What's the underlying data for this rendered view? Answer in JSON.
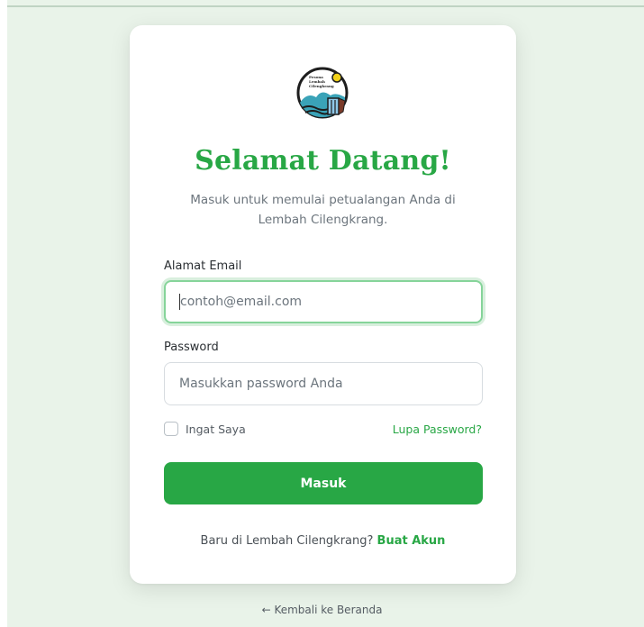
{
  "logo": {
    "line1": "Pesona",
    "line2": "Lembah",
    "line3": "Cilengkrang"
  },
  "heading": {
    "title": "Selamat Datang!",
    "subtitle": "Masuk untuk memulai petualangan Anda di Lembah Cilengkrang."
  },
  "form": {
    "email_label": "Alamat Email",
    "email_value": "",
    "email_placeholder": "contoh@email.com",
    "password_label": "Password",
    "password_value": "",
    "password_placeholder": "Masukkan password Anda",
    "remember_label": "Ingat Saya",
    "remember_checked": false,
    "forgot_link": "Lupa Password?",
    "submit_label": "Masuk"
  },
  "signup": {
    "prompt": "Baru di Lembah Cilengkrang?",
    "link": "Buat Akun"
  },
  "footer": {
    "back_arrow": "←",
    "back_label": "Kembali ke Beranda"
  },
  "colors": {
    "accent": "#28a745",
    "background": "#e9f3e9",
    "card": "#ffffff"
  }
}
